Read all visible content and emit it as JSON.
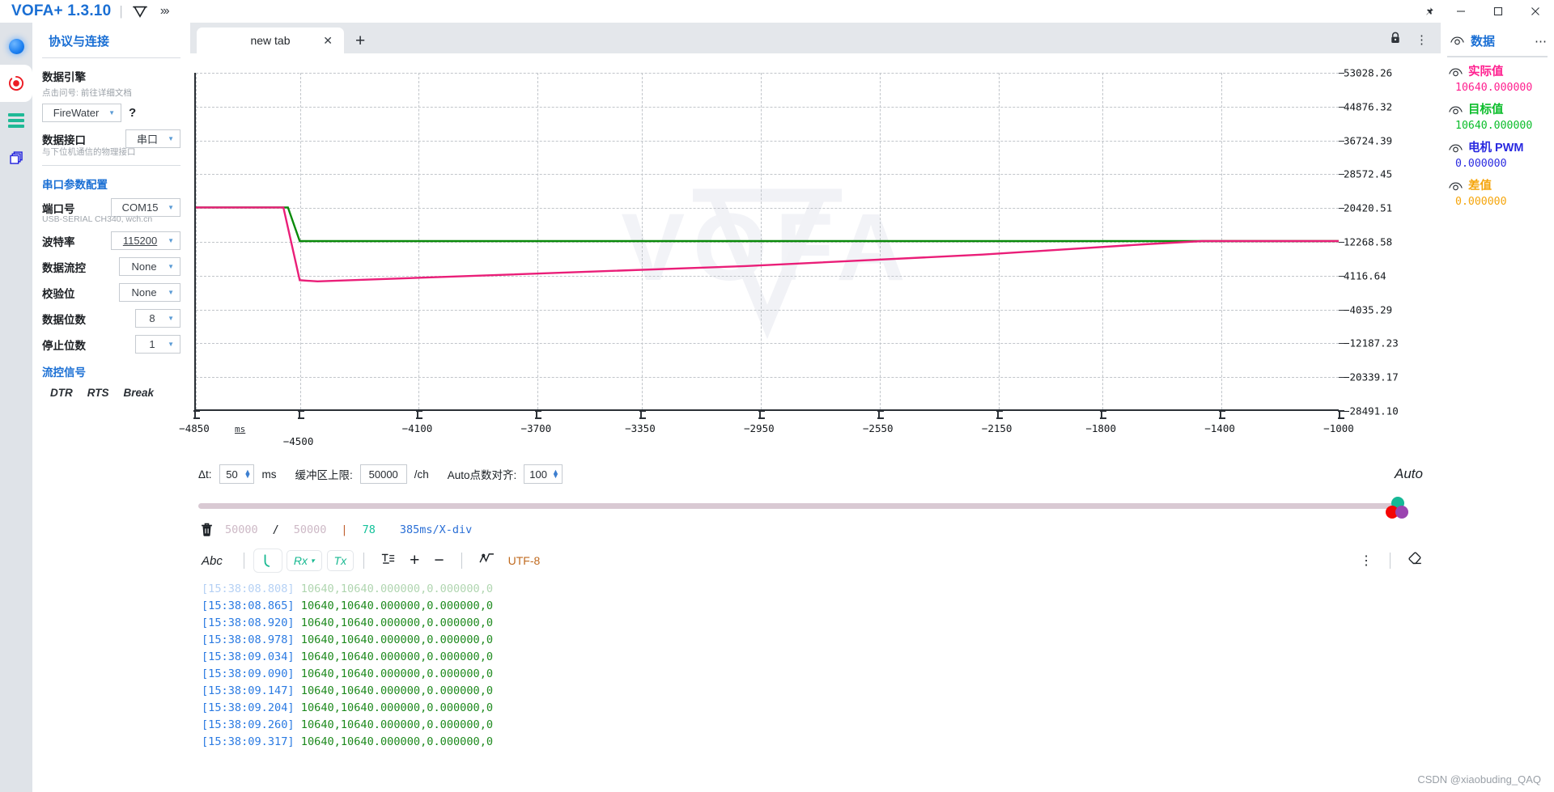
{
  "titlebar": {
    "brand": "VOFA+ 1.3.10",
    "logo_icon": "vofa-v-logo-icon",
    "expand_icon": "chevron-triple-right-icon",
    "pin_icon": "pin-icon",
    "minimize_icon": "minimize-icon",
    "maximize_icon": "maximize-icon",
    "close_icon": "close-icon"
  },
  "rail": {
    "items": [
      {
        "name": "connection-status-indicator",
        "icon": "blue-sphere-icon"
      },
      {
        "name": "record-button",
        "icon": "record-icon"
      },
      {
        "name": "channels-button",
        "icon": "bars-icon"
      },
      {
        "name": "layers-button",
        "icon": "copy-layers-icon"
      }
    ]
  },
  "sidebar": {
    "title": "协议与连接",
    "data_engine": {
      "heading": "数据引擎",
      "hint": "点击问号: 前往详细文档",
      "value": "FireWater",
      "help_label": "?"
    },
    "data_interface": {
      "heading": "数据接口",
      "value": "串口",
      "hint": "与下位机通信的物理接口"
    },
    "serial_config": {
      "heading": "串口参数配置",
      "port": {
        "label": "端口号",
        "value": "COM15",
        "hint": "USB-SERIAL CH340, wch.cn"
      },
      "baud": {
        "label": "波特率",
        "value": "115200"
      },
      "flow": {
        "label": "数据流控",
        "value": "None"
      },
      "parity": {
        "label": "校验位",
        "value": "None"
      },
      "databits": {
        "label": "数据位数",
        "value": "8"
      },
      "stopbits": {
        "label": "停止位数",
        "value": "1"
      },
      "signals": {
        "label": "流控信号",
        "buttons": [
          "DTR",
          "RTS",
          "Break"
        ]
      }
    }
  },
  "tabs": {
    "items": [
      {
        "label": "new tab",
        "close_icon": "close-icon"
      }
    ],
    "add_icon": "plus-icon",
    "lock_icon": "lock-icon",
    "menu_icon": "kebab-menu-icon"
  },
  "chart_data": {
    "type": "line",
    "title": "",
    "xlabel": "ms",
    "ylabel": "",
    "grid": true,
    "legend": "none",
    "watermark": "VOFA",
    "xlim": [
      -4850,
      -1000
    ],
    "ylim": [
      -28491.1,
      53028.26
    ],
    "x_ticks": [
      -4850,
      -4500,
      -4100,
      -3700,
      -3350,
      -2950,
      -2550,
      -2150,
      -1800,
      -1400,
      -1000
    ],
    "y_ticks": [
      53028.26,
      44876.32,
      36724.39,
      28572.45,
      20420.51,
      12268.58,
      4116.64,
      -4035.29,
      -12187.23,
      -20339.17,
      -28491.1
    ],
    "series": [
      {
        "name": "目标值",
        "color": "#0a8a0a",
        "points": [
          [
            -4850,
            20420
          ],
          [
            -4540,
            20420
          ],
          [
            -4500,
            12268
          ],
          [
            -1000,
            12268
          ]
        ]
      },
      {
        "name": "实际值",
        "color": "#ea1e78",
        "points": [
          [
            -4850,
            20420
          ],
          [
            -4555,
            20420
          ],
          [
            -4500,
            2800
          ],
          [
            -4440,
            2500
          ],
          [
            -3000,
            6200
          ],
          [
            -2200,
            9000
          ],
          [
            -1650,
            11500
          ],
          [
            -1460,
            12268
          ],
          [
            -1000,
            12268
          ]
        ]
      }
    ]
  },
  "chart_controls": {
    "dt_label": "Δt:",
    "dt_value": "50",
    "dt_unit": "ms",
    "buffer_label": "缓冲区上限:",
    "buffer_value": "50000",
    "buffer_unit": "/ch",
    "align_label": "Auto点数对齐:",
    "align_value": "100",
    "auto_label": "Auto"
  },
  "status": {
    "trash_icon": "trash-icon",
    "used": "50000",
    "separator": "/",
    "total": "50000",
    "pipe": "|",
    "fps": "78",
    "timebase": "385ms/X-div"
  },
  "terminal_toolbar": {
    "abc_label": "Abc",
    "hook_icon": "hook-curve-icon",
    "rx_label": "Rx",
    "rx_caret_icon": "chevron-down-icon",
    "tx_label": "Tx",
    "wrap_icon": "text-format-icon",
    "plus_icon": "plus-icon",
    "minus_icon": "minus-icon",
    "waveform_icon": "waveform-icon",
    "encoding": "UTF-8",
    "menu_icon": "kebab-menu-icon",
    "erase_icon": "eraser-icon"
  },
  "console": {
    "lines": [
      {
        "ts": "[15:38:08.808]",
        "payload": "10640,10640.000000,0.000000,0"
      },
      {
        "ts": "[15:38:08.865]",
        "payload": "10640,10640.000000,0.000000,0"
      },
      {
        "ts": "[15:38:08.920]",
        "payload": "10640,10640.000000,0.000000,0"
      },
      {
        "ts": "[15:38:08.978]",
        "payload": "10640,10640.000000,0.000000,0"
      },
      {
        "ts": "[15:38:09.034]",
        "payload": "10640,10640.000000,0.000000,0"
      },
      {
        "ts": "[15:38:09.090]",
        "payload": "10640,10640.000000,0.000000,0"
      },
      {
        "ts": "[15:38:09.147]",
        "payload": "10640,10640.000000,0.000000,0"
      },
      {
        "ts": "[15:38:09.204]",
        "payload": "10640,10640.000000,0.000000,0"
      },
      {
        "ts": "[15:38:09.260]",
        "payload": "10640,10640.000000,0.000000,0"
      },
      {
        "ts": "[15:38:09.317]",
        "payload": "10640,10640.000000,0.000000,0"
      }
    ]
  },
  "right_panel": {
    "title": "数据",
    "menu_icon": "kebab-horizontal-icon",
    "items": [
      {
        "label": "实际值",
        "value": "10640.000000",
        "color": "#ff1f8f"
      },
      {
        "label": "目标值",
        "value": "10640.000000",
        "color": "#0bbd2a"
      },
      {
        "label": "电机 PWM",
        "value": "0.000000",
        "color": "#2a2ae0"
      },
      {
        "label": "差值",
        "value": "0.000000",
        "color": "#f5a50b"
      }
    ]
  },
  "credit": "CSDN @xiaobuding_QAQ"
}
